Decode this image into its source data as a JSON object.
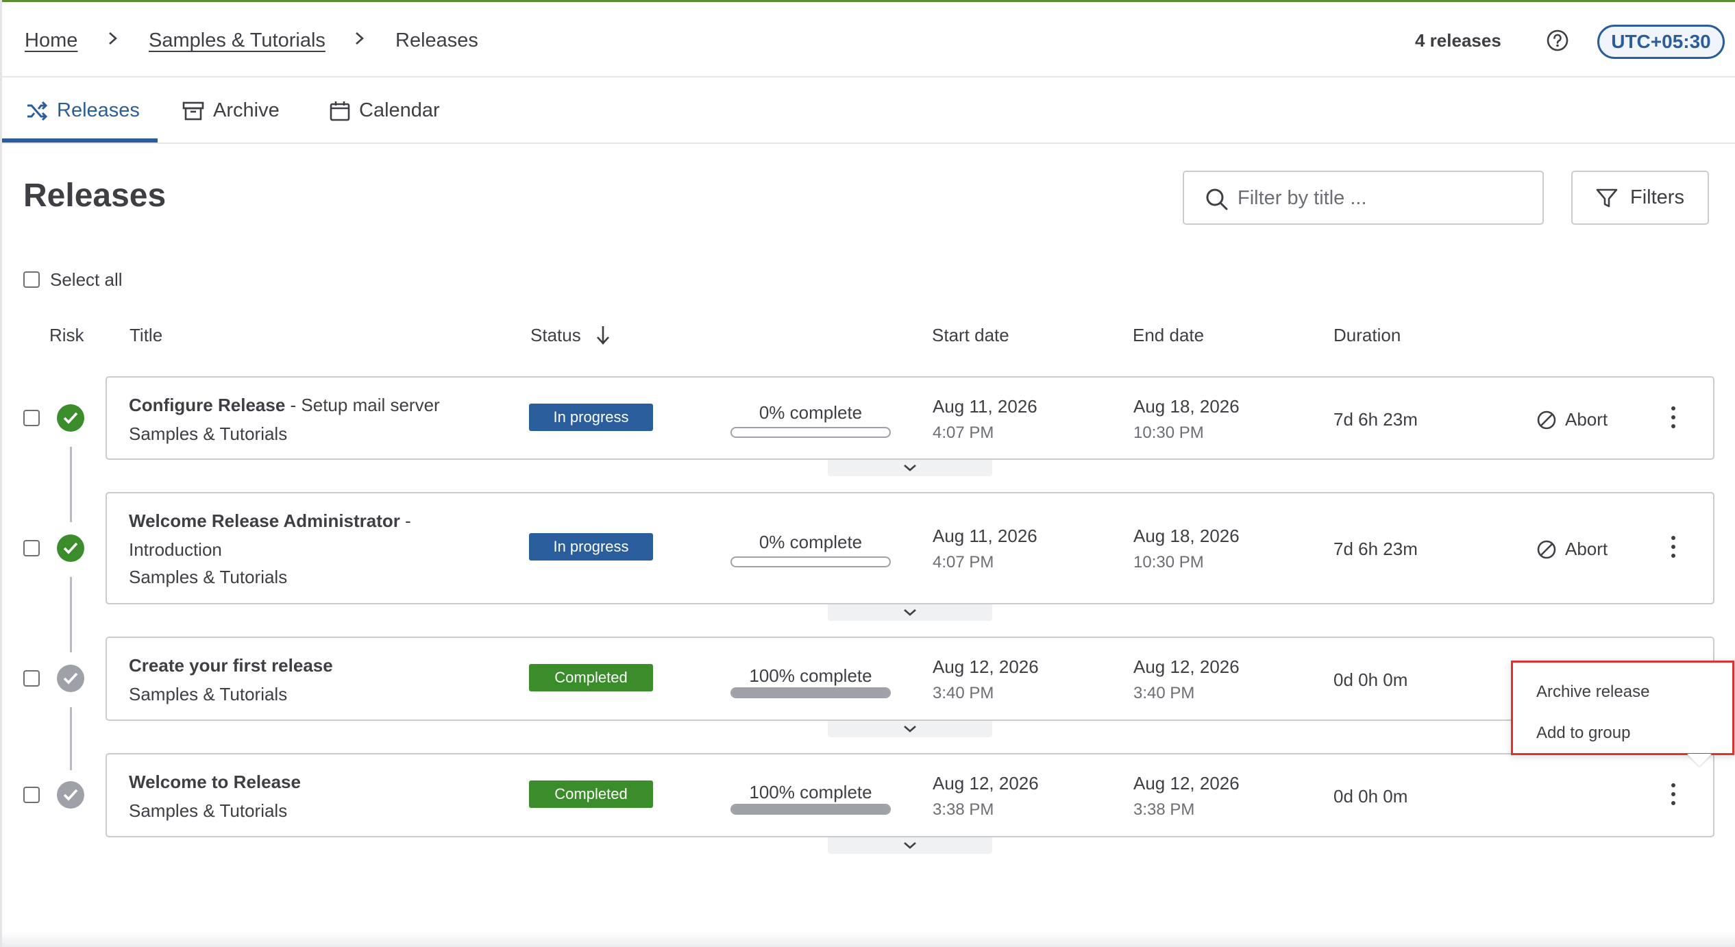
{
  "breadcrumb": {
    "home": "Home",
    "folder": "Samples & Tutorials",
    "current": "Releases",
    "separator": ">"
  },
  "header": {
    "release_count": "4 releases",
    "timezone": "UTC+05:30"
  },
  "tabs": [
    {
      "label": "Releases",
      "icon": "shuffle-icon",
      "active": true
    },
    {
      "label": "Archive",
      "icon": "archive-box-icon",
      "active": false
    },
    {
      "label": "Calendar",
      "icon": "calendar-icon",
      "active": false
    }
  ],
  "page": {
    "title": "Releases",
    "search_placeholder": "Filter by title ...",
    "filters_label": "Filters",
    "select_all_label": "Select all"
  },
  "columns": {
    "risk": "Risk",
    "title": "Title",
    "status": "Status",
    "start_date": "Start date",
    "end_date": "End date",
    "duration": "Duration"
  },
  "releases": [
    {
      "title_bold": "Configure Release",
      "title_rest": " - Setup mail server",
      "folder": "Samples & Tutorials",
      "status": "In progress",
      "progress_label": "0% complete",
      "progress_fraction": 0.0,
      "start_date": "Aug 11, 2026",
      "start_time": "4:07 PM",
      "end_date": "Aug 18, 2026",
      "end_time": "10:30 PM",
      "duration": "7d 6h 23m",
      "action": "Abort"
    },
    {
      "title_bold": "Welcome Release Administrator",
      "title_rest": " -",
      "title_line2": "Introduction",
      "folder": "Samples & Tutorials",
      "status": "In progress",
      "progress_label": "0% complete",
      "progress_fraction": 0.0,
      "start_date": "Aug 11, 2026",
      "start_time": "4:07 PM",
      "end_date": "Aug 18, 2026",
      "end_time": "10:30 PM",
      "duration": "7d 6h 23m",
      "action": "Abort"
    },
    {
      "title_bold": "Create your first release",
      "folder": "Samples & Tutorials",
      "status": "Completed",
      "progress_label": "100% complete",
      "progress_fraction": 1.0,
      "start_date": "Aug 12, 2026",
      "start_time": "3:40 PM",
      "end_date": "Aug 12, 2026",
      "end_time": "3:40 PM",
      "duration": "0d 0h 0m"
    },
    {
      "title_bold": "Welcome to Release",
      "folder": "Samples & Tutorials",
      "status": "Completed",
      "progress_label": "100% complete",
      "progress_fraction": 1.0,
      "start_date": "Aug 12, 2026",
      "start_time": "3:38 PM",
      "end_date": "Aug 12, 2026",
      "end_time": "3:38 PM",
      "duration": "0d 0h 0m"
    }
  ],
  "context_menu": {
    "items": [
      "Archive release",
      "Add to group"
    ]
  },
  "colors": {
    "accent": "#2a5d9b",
    "success": "#3b8c2a",
    "highlight_border": "#e0322c",
    "top_bar": "#5a8f2e"
  }
}
